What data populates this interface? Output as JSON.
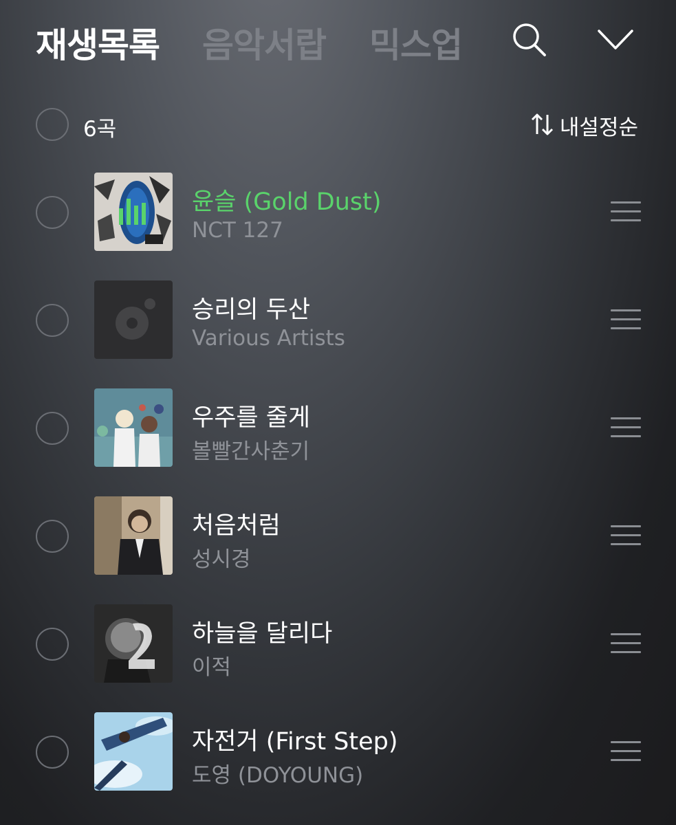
{
  "tabs": [
    {
      "label": "재생목록",
      "active": true
    },
    {
      "label": "음악서랍",
      "active": false
    },
    {
      "label": "믹스업",
      "active": false
    }
  ],
  "header_icons": {
    "search": "search-icon",
    "collapse": "chevron-down-icon"
  },
  "playlist": {
    "count_label": "6곡",
    "sort_label": "내설정순",
    "sort_icon": "sort-arrows-icon"
  },
  "colors": {
    "playing_accent": "#5ad36b",
    "active_tab": "#ffffff",
    "inactive_tab": "#7d8087"
  },
  "songs": [
    {
      "title": "윤슬 (Gold Dust)",
      "artist": "NCT 127",
      "playing": true
    },
    {
      "title": "승리의 두산",
      "artist": "Various Artists",
      "playing": false
    },
    {
      "title": "우주를 줄게",
      "artist": "볼빨간사춘기",
      "playing": false
    },
    {
      "title": "처음처럼",
      "artist": "성시경",
      "playing": false
    },
    {
      "title": "하늘을 달리다",
      "artist": "이적",
      "playing": false
    },
    {
      "title": "자전거 (First Step)",
      "artist": "도영 (DOYOUNG)",
      "playing": false
    }
  ]
}
